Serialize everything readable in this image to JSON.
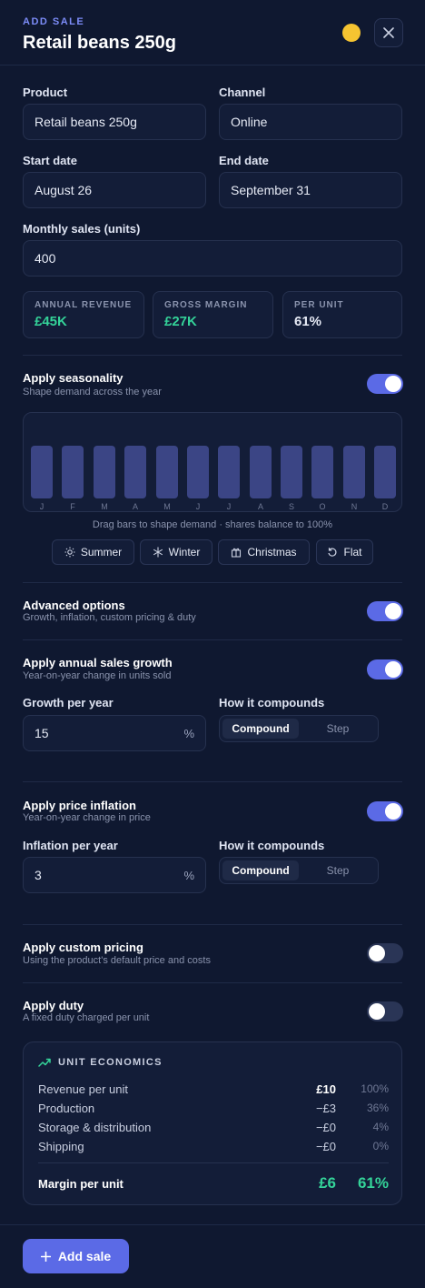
{
  "header": {
    "eyebrow": "ADD SALE",
    "title": "Retail beans 250g",
    "status_color": "#f6c431"
  },
  "form": {
    "product_label": "Product",
    "product_value": "Retail beans 250g",
    "channel_label": "Channel",
    "channel_value": "Online",
    "start_label": "Start date",
    "start_value": "August 26",
    "end_label": "End date",
    "end_value": "September 31",
    "monthly_label": "Monthly sales (units)",
    "monthly_value": "400"
  },
  "stats": [
    {
      "label": "ANNUAL REVENUE",
      "value": "£45K"
    },
    {
      "label": "GROSS MARGIN",
      "value": "£27K"
    },
    {
      "label": "PER UNIT",
      "value": "61%"
    }
  ],
  "seasonality": {
    "title": "Apply seasonality",
    "subtitle": "Shape demand across the year",
    "enabled": true,
    "months": [
      "J",
      "F",
      "M",
      "A",
      "M",
      "J",
      "J",
      "A",
      "S",
      "O",
      "N",
      "D"
    ],
    "hint": "Drag bars to shape demand · shares balance to 100%",
    "presets": [
      "Summer",
      "Winter",
      "Christmas",
      "Flat"
    ]
  },
  "advanced": {
    "title": "Advanced options",
    "subtitle": "Growth, inflation, custom pricing & duty",
    "enabled": true
  },
  "growth": {
    "title": "Apply annual sales growth",
    "subtitle": "Year-on-year change in units sold",
    "enabled": true,
    "rate_label": "Growth per year",
    "rate_value": "15",
    "suffix": "%",
    "compound_label": "How it compounds",
    "options": [
      "Compound",
      "Step"
    ]
  },
  "inflation": {
    "title": "Apply price inflation",
    "subtitle": "Year-on-year change in price",
    "enabled": true,
    "rate_label": "Inflation per year",
    "rate_value": "3",
    "suffix": "%",
    "compound_label": "How it compounds",
    "options": [
      "Compound",
      "Step"
    ]
  },
  "custom_pricing": {
    "title": "Apply custom pricing",
    "subtitle": "Using the product's default price and costs",
    "enabled": false
  },
  "duty": {
    "title": "Apply duty",
    "subtitle": "A fixed duty charged per unit",
    "enabled": false
  },
  "economics": {
    "heading": "UNIT ECONOMICS",
    "rows": [
      {
        "name": "Revenue per unit",
        "value": "£10",
        "pct": "100%"
      },
      {
        "name": "Production",
        "value": "−£3",
        "pct": "36%"
      },
      {
        "name": "Storage & distribution",
        "value": "−£0",
        "pct": "4%"
      },
      {
        "name": "Shipping",
        "value": "−£0",
        "pct": "0%"
      }
    ],
    "margin": {
      "name": "Margin per unit",
      "value": "£6",
      "pct": "61%"
    }
  },
  "footer": {
    "add_label": "Add sale"
  },
  "colors": {
    "accent": "#5b6ae6",
    "positive": "#34d399",
    "background": "#0f1830"
  }
}
